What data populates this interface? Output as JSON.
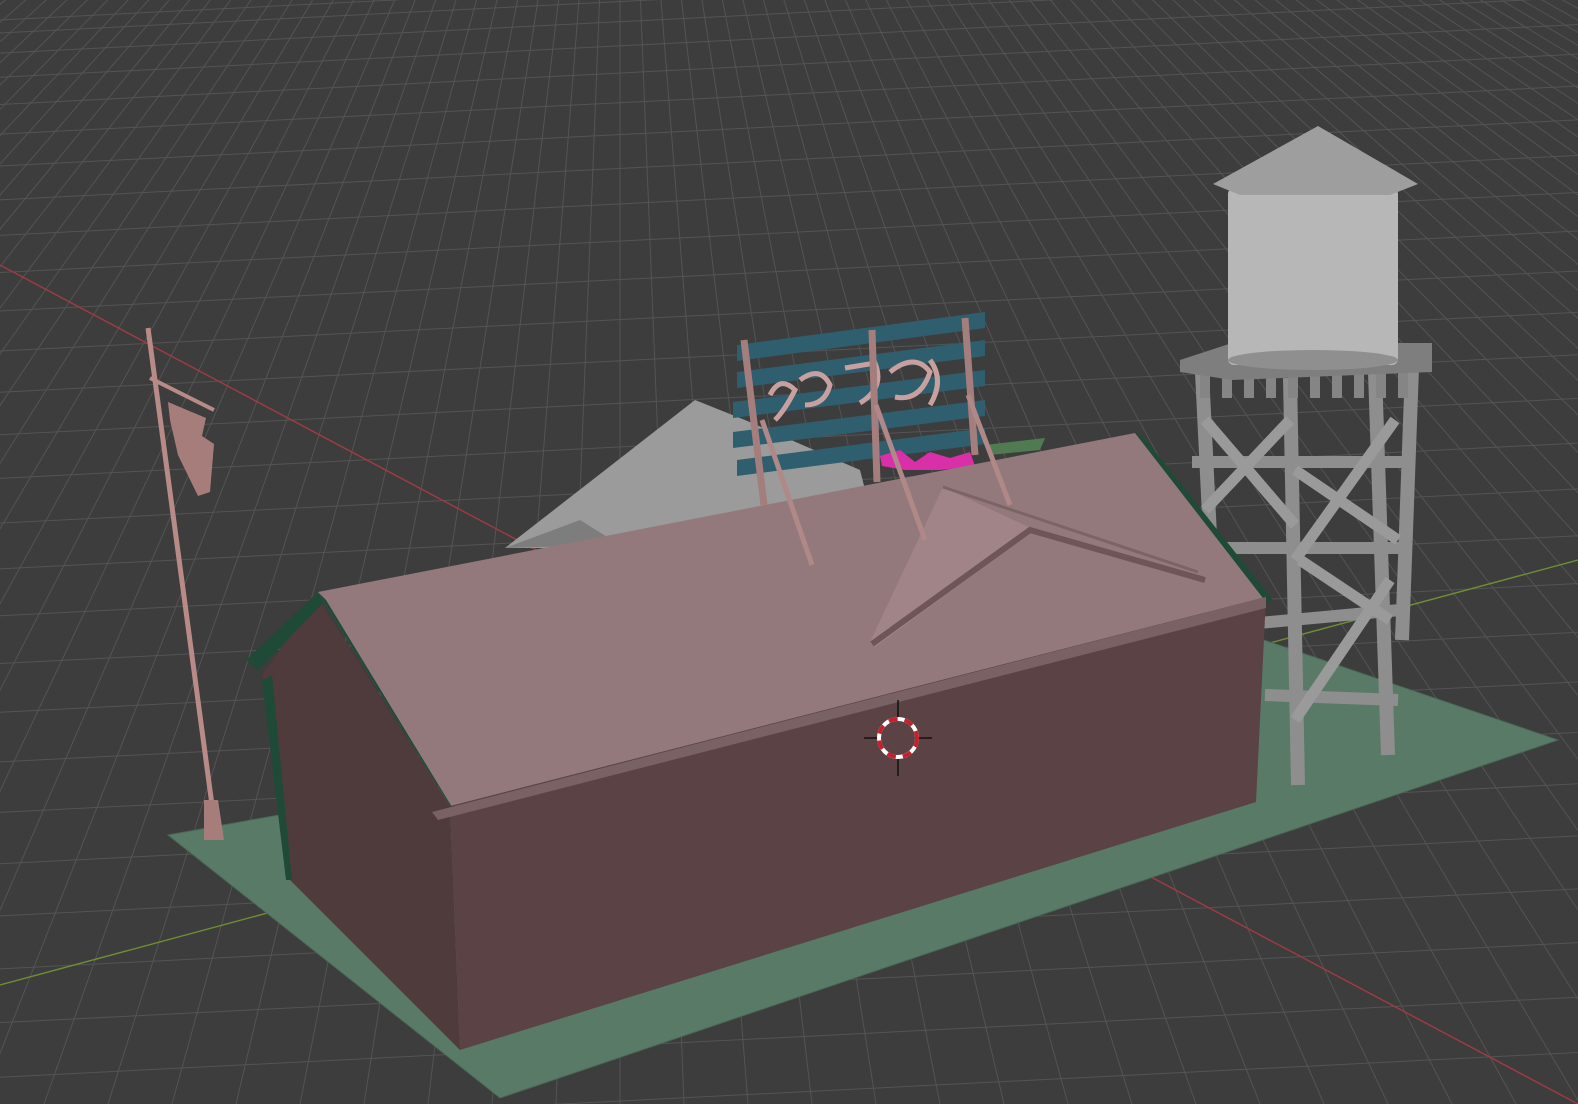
{
  "app": {
    "editor": "3D Viewport"
  },
  "colors": {
    "background": "#3d3d3d",
    "grid_line": "#545454",
    "x_axis": "#a23a44",
    "y_axis": "#6f8f34",
    "base_plate": "#5a7a68",
    "building_wall_front": "#5b4244",
    "building_wall_end": "#4f3a3c",
    "building_roof": "#93797c",
    "roof_trim": "#1f4a38",
    "rear_roof": "#9b9b9b",
    "billboard_boards": "#2f5f6e",
    "billboard_posts": "#a47d7d",
    "flower_box": "#d92fa8",
    "water_tank": "#b7b7b7",
    "water_tank_roof": "#9e9e9e",
    "tower_frame": "#8e8e8e",
    "sign_pole": "#b88a88",
    "cursor_red": "#c8202a",
    "cursor_white": "#ffffff"
  },
  "scene": {
    "objects": [
      "base-plate",
      "general-store-building",
      "rear-roof",
      "rooftop-billboard",
      "water-tower",
      "sign-pole",
      "hanging-sign"
    ]
  },
  "icons": {
    "3d_cursor": "3d-cursor-icon"
  }
}
